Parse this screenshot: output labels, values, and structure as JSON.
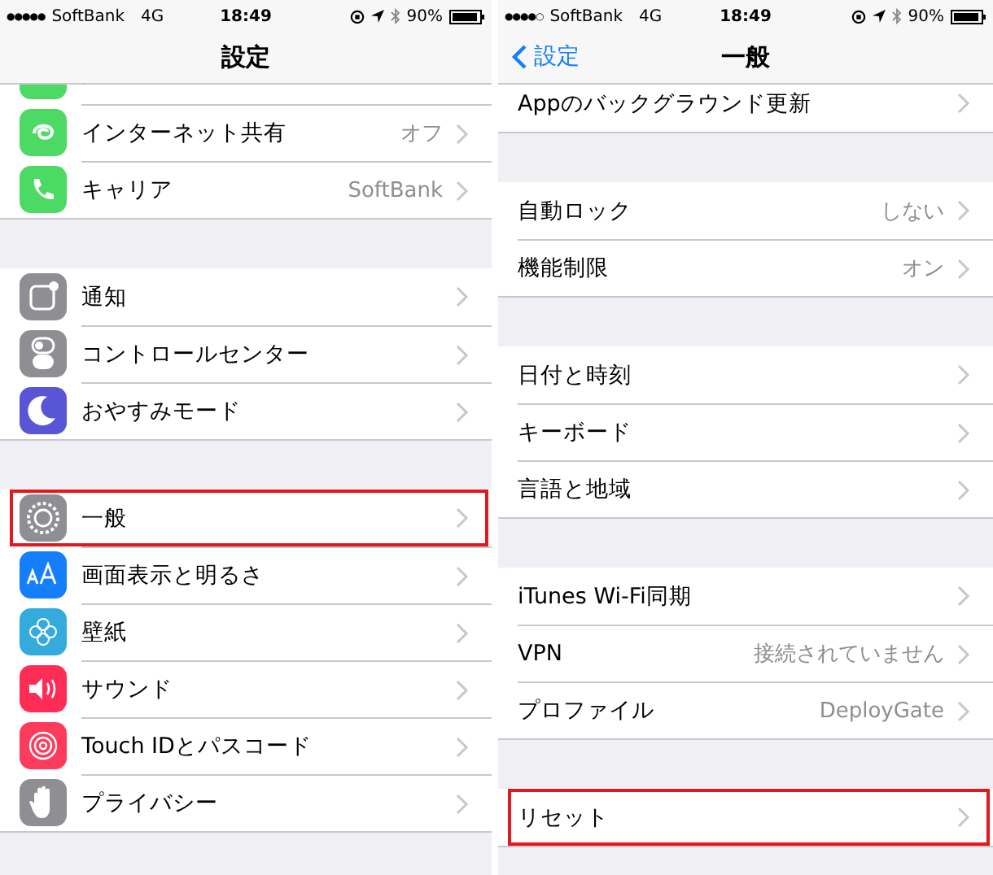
{
  "screens": [
    {
      "status_bar": {
        "signal": "●●●●●",
        "carrier": "SoftBank",
        "network": "4G",
        "time": "18:49",
        "battery": "90%"
      },
      "nav": {
        "title": "設定"
      },
      "groups": [
        [
          {
            "color": "#4cd964",
            "highlighted": false
          },
          {
            "label": "インターネット共有",
            "value": "オフ",
            "color": "#4cd964",
            "highlighted": false
          },
          {
            "label": "キャリア",
            "value": "SoftBank",
            "color": "#4cd964",
            "highlighted": false
          }
        ],
        [
          {
            "label": "通知",
            "color": "#8e8e93",
            "highlighted": false
          },
          {
            "label": "コントロールセンター",
            "color": "#8e8e93",
            "highlighted": false
          },
          {
            "label": "おやすみモード",
            "color": "#5856d6",
            "highlighted": false
          }
        ],
        [
          {
            "label": "一般",
            "color": "#8e8e93",
            "highlighted": true
          },
          {
            "label": "画面表示と明るさ",
            "color": "#147efb",
            "highlighted": false
          },
          {
            "label": "壁紙",
            "color": "#35aadc",
            "highlighted": false
          },
          {
            "label": "サウンド",
            "color": "#ff2d55",
            "highlighted": false
          },
          {
            "label": "Touch IDとパスコード",
            "color": "#ff3b5c",
            "highlighted": false
          },
          {
            "label": "プライバシー",
            "color": "#8e8e93",
            "highlighted": false
          }
        ]
      ]
    },
    {
      "status_bar": {
        "signal": "●●●●○",
        "carrier": "SoftBank",
        "network": "4G",
        "time": "18:49",
        "battery": "90%"
      },
      "nav": {
        "back": "設定",
        "title": "一般"
      },
      "groups": [
        [
          {
            "label": "Appのバックグラウンド更新",
            "highlighted": false
          }
        ],
        [
          {
            "label": "自動ロック",
            "value": "しない",
            "highlighted": false
          },
          {
            "label": "機能制限",
            "value": "オン",
            "highlighted": false
          }
        ],
        [
          {
            "label": "日付と時刻",
            "highlighted": false
          },
          {
            "label": "キーボード",
            "highlighted": false
          },
          {
            "label": "言語と地域",
            "highlighted": false
          }
        ],
        [
          {
            "label": "iTunes Wi-Fi同期",
            "highlighted": false
          },
          {
            "label": "VPN",
            "value": "接続されていません",
            "highlighted": false
          },
          {
            "label": "プロファイル",
            "value": "DeployGate",
            "highlighted": false
          }
        ],
        [
          {
            "label": "リセット",
            "highlighted": true
          }
        ]
      ]
    }
  ]
}
